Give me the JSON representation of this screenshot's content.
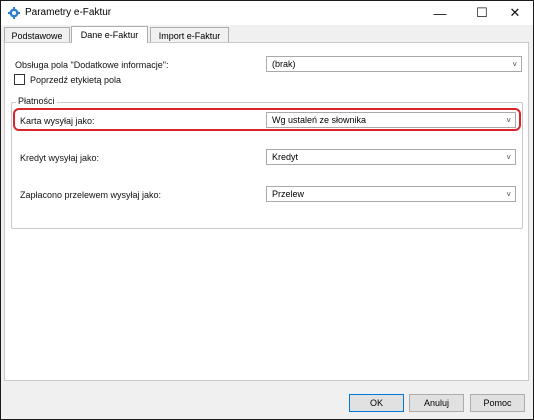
{
  "window": {
    "title": "Parametry e-Faktur",
    "minimize": "—",
    "maximize": "☐",
    "close": "✕"
  },
  "tabs": [
    {
      "label": "Podstawowe",
      "active": false
    },
    {
      "label": "Dane e-Faktur",
      "active": true
    },
    {
      "label": "Import e-Faktur",
      "active": false
    }
  ],
  "fields": {
    "dodatkowe_label": "Obsługa pola \"Dodatkowe informacje\":",
    "dodatkowe_value": "(brak)",
    "poprzedz_label": "Poprzedź etykietą pola",
    "poprzedz_checked": false
  },
  "payments": {
    "group_title": "Płatności",
    "karta_label": "Karta wysyłaj jako:",
    "karta_value": "Wg ustaleń ze słownika",
    "kredyt_label": "Kredyt wysyłaj jako:",
    "kredyt_value": "Kredyt",
    "przelew_label": "Zapłacono przelewem wysyłaj jako:",
    "przelew_value": "Przelew"
  },
  "buttons": {
    "ok": "OK",
    "cancel": "Anuluj",
    "help": "Pomoc"
  },
  "icons": {
    "dropdown": "˅"
  },
  "colors": {
    "highlight": "#d9252a",
    "ok_border": "#0078d7"
  }
}
